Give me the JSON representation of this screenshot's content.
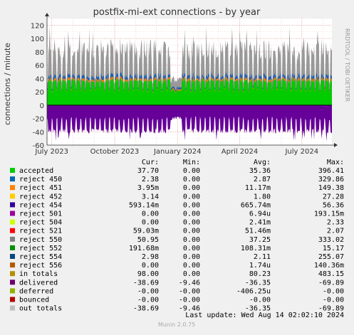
{
  "chart_data": {
    "type": "area",
    "title": "postfix-mi-ext connections - by year",
    "ylabel": "connections / minute",
    "side_label": "RRDTOOL / TOBI OETIKER",
    "ylim": [
      -60,
      130
    ],
    "yticks": [
      -60,
      -40,
      -20,
      0,
      20,
      40,
      60,
      80,
      100,
      120
    ],
    "xticks": [
      {
        "label": "July 2023",
        "date": "2023-07-01"
      },
      {
        "label": "October 2023",
        "date": "2023-10-01"
      },
      {
        "label": "January 2024",
        "date": "2024-01-01"
      },
      {
        "label": "April 2024",
        "date": "2024-04-01"
      },
      {
        "label": "July 2024",
        "date": "2024-07-01"
      }
    ],
    "x_range": [
      "2023-06-24",
      "2024-08-14"
    ],
    "grid": true,
    "series_envelopes": [
      {
        "name": "accepted",
        "color": "#00cc00",
        "weekday_level": 38,
        "weekend_level": 22
      },
      {
        "name": "reject totals (stacked)",
        "color": "#1a5fb4",
        "weekday_level": 45,
        "weekend_level": 25
      },
      {
        "name": "in totals",
        "color": "#999999",
        "weekday_peak": 80,
        "max_peak": 125
      },
      {
        "name": "delivered",
        "color": "#660099",
        "weekday_level": -40,
        "weekend_level": -22
      }
    ],
    "legend_header": {
      "cur": "Cur:",
      "min": "Min:",
      "avg": "Avg:",
      "max": "Max:"
    },
    "legend": [
      {
        "name": "accepted",
        "color": "#00cc00",
        "cur": "37.70",
        "min": "0.00",
        "avg": "35.36",
        "max": "396.41"
      },
      {
        "name": "reject 450",
        "color": "#0066b3",
        "cur": "2.38",
        "min": "0.00",
        "avg": "2.87",
        "max": "329.86"
      },
      {
        "name": "reject 451",
        "color": "#ff8000",
        "cur": "3.95m",
        "min": "0.00",
        "avg": "11.17m",
        "max": "149.38"
      },
      {
        "name": "reject 452",
        "color": "#ffcc00",
        "cur": "3.14",
        "min": "0.00",
        "avg": "1.80",
        "max": "27.28"
      },
      {
        "name": "reject 454",
        "color": "#330099",
        "cur": "593.14m",
        "min": "0.00",
        "avg": "665.74m",
        "max": "56.36"
      },
      {
        "name": "reject 501",
        "color": "#990099",
        "cur": "0.00",
        "min": "0.00",
        "avg": "6.94u",
        "max": "193.15m"
      },
      {
        "name": "reject 504",
        "color": "#ccff00",
        "cur": "0.00",
        "min": "0.00",
        "avg": "2.41m",
        "max": "2.33"
      },
      {
        "name": "reject 521",
        "color": "#ff0000",
        "cur": "59.03m",
        "min": "0.00",
        "avg": "51.46m",
        "max": "2.07"
      },
      {
        "name": "reject 550",
        "color": "#808080",
        "cur": "50.95",
        "min": "0.00",
        "avg": "37.25",
        "max": "333.02"
      },
      {
        "name": "reject 552",
        "color": "#008f00",
        "cur": "191.68m",
        "min": "0.00",
        "avg": "108.31m",
        "max": "15.17"
      },
      {
        "name": "reject 554",
        "color": "#00487d",
        "cur": "2.98",
        "min": "0.00",
        "avg": "2.11",
        "max": "255.07"
      },
      {
        "name": "reject 556",
        "color": "#b35a00",
        "cur": "0.00",
        "min": "0.00",
        "avg": "1.74u",
        "max": "140.36m"
      },
      {
        "name": "in totals",
        "color": "#b38f00",
        "cur": "98.00",
        "min": "0.00",
        "avg": "80.23",
        "max": "483.15"
      },
      {
        "name": "delivered",
        "color": "#6b006b",
        "cur": "-38.69",
        "min": "-9.46",
        "avg": "-36.35",
        "max": "-69.89"
      },
      {
        "name": "deferred",
        "color": "#8fb300",
        "cur": "-0.00",
        "min": "-0.00",
        "avg": "-406.25u",
        "max": "-0.00"
      },
      {
        "name": "bounced",
        "color": "#b30000",
        "cur": "-0.00",
        "min": "-0.00",
        "avg": "-0.00",
        "max": "-0.00"
      },
      {
        "name": "out totals",
        "color": "#bebebe",
        "cur": "-38.69",
        "min": "-9.46",
        "avg": "-36.35",
        "max": "-69.89"
      }
    ],
    "last_update": "Last update:  Wed Aug 14 02:02:10 2024",
    "footer": "Munin 2.0.75"
  }
}
